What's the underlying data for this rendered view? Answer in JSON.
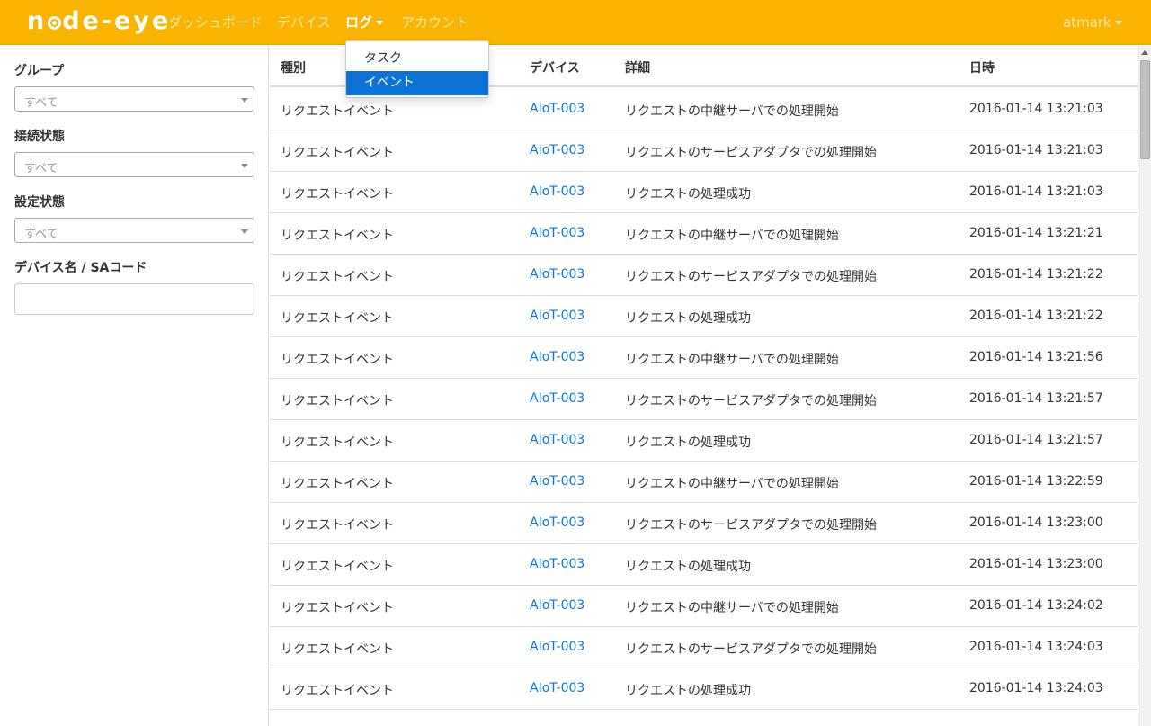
{
  "navbar": {
    "brand_prefix": "n",
    "brand_suffix": "de-eye",
    "items": [
      {
        "label": "ダッシュボード"
      },
      {
        "label": "デバイス"
      },
      {
        "label": "ログ"
      },
      {
        "label": "アカウント"
      }
    ],
    "user": "atmark",
    "accent_color": "#f8b400"
  },
  "dropdown": {
    "items": [
      {
        "label": "タスク"
      },
      {
        "label": "イベント"
      }
    ],
    "selected": "イベント"
  },
  "sidebar": {
    "filters": [
      {
        "label": "グループ",
        "value": "すべて"
      },
      {
        "label": "接続状態",
        "value": "すべて"
      },
      {
        "label": "設定状態",
        "value": "すべて"
      }
    ],
    "search_label": "デバイス名 / SAコード",
    "search_value": ""
  },
  "table": {
    "headers": [
      "種別",
      "デバイス",
      "詳細",
      "日時"
    ],
    "rows": [
      {
        "type": "リクエストイベント",
        "device": "AIoT-003",
        "detail": "リクエストの中継サーバでの処理開始",
        "datetime": "2016-01-14 13:21:03"
      },
      {
        "type": "リクエストイベント",
        "device": "AIoT-003",
        "detail": "リクエストのサービスアダプタでの処理開始",
        "datetime": "2016-01-14 13:21:03"
      },
      {
        "type": "リクエストイベント",
        "device": "AIoT-003",
        "detail": "リクエストの処理成功",
        "datetime": "2016-01-14 13:21:03"
      },
      {
        "type": "リクエストイベント",
        "device": "AIoT-003",
        "detail": "リクエストの中継サーバでの処理開始",
        "datetime": "2016-01-14 13:21:21"
      },
      {
        "type": "リクエストイベント",
        "device": "AIoT-003",
        "detail": "リクエストのサービスアダプタでの処理開始",
        "datetime": "2016-01-14 13:21:22"
      },
      {
        "type": "リクエストイベント",
        "device": "AIoT-003",
        "detail": "リクエストの処理成功",
        "datetime": "2016-01-14 13:21:22"
      },
      {
        "type": "リクエストイベント",
        "device": "AIoT-003",
        "detail": "リクエストの中継サーバでの処理開始",
        "datetime": "2016-01-14 13:21:56"
      },
      {
        "type": "リクエストイベント",
        "device": "AIoT-003",
        "detail": "リクエストのサービスアダプタでの処理開始",
        "datetime": "2016-01-14 13:21:57"
      },
      {
        "type": "リクエストイベント",
        "device": "AIoT-003",
        "detail": "リクエストの処理成功",
        "datetime": "2016-01-14 13:21:57"
      },
      {
        "type": "リクエストイベント",
        "device": "AIoT-003",
        "detail": "リクエストの中継サーバでの処理開始",
        "datetime": "2016-01-14 13:22:59"
      },
      {
        "type": "リクエストイベント",
        "device": "AIoT-003",
        "detail": "リクエストのサービスアダプタでの処理開始",
        "datetime": "2016-01-14 13:23:00"
      },
      {
        "type": "リクエストイベント",
        "device": "AIoT-003",
        "detail": "リクエストの処理成功",
        "datetime": "2016-01-14 13:23:00"
      },
      {
        "type": "リクエストイベント",
        "device": "AIoT-003",
        "detail": "リクエストの中継サーバでの処理開始",
        "datetime": "2016-01-14 13:24:02"
      },
      {
        "type": "リクエストイベント",
        "device": "AIoT-003",
        "detail": "リクエストのサービスアダプタでの処理開始",
        "datetime": "2016-01-14 13:24:03"
      },
      {
        "type": "リクエストイベント",
        "device": "AIoT-003",
        "detail": "リクエストの処理成功",
        "datetime": "2016-01-14 13:24:03"
      }
    ]
  }
}
